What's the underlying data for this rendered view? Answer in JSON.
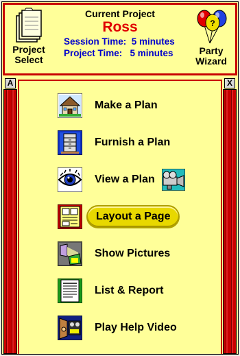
{
  "header": {
    "current_project_label": "Current Project",
    "project_name": "Ross",
    "session_time": "Session Time:  5 minutes",
    "project_time": "Project Time:   5 minutes",
    "project_select_label_1": "Project",
    "project_select_label_2": "Select",
    "party_wizard_label_1": "Party",
    "party_wizard_label_2": "Wizard"
  },
  "frame": {
    "left_button": "A",
    "right_button": "X"
  },
  "menu": {
    "items": [
      {
        "label": "Make a Plan",
        "icon": "house-icon"
      },
      {
        "label": "Furnish a Plan",
        "icon": "furniture-icon"
      },
      {
        "label": "View a Plan",
        "icon": "eye-icon"
      },
      {
        "label": "Layout a Page",
        "icon": "page-layout-icon"
      },
      {
        "label": "Show Pictures",
        "icon": "projector-icon"
      },
      {
        "label": "List & Report",
        "icon": "report-icon"
      },
      {
        "label": "Play Help Video",
        "icon": "video-icon"
      }
    ],
    "selected": "Layout a Page",
    "extra_icon": "video-camera-icon"
  },
  "colors": {
    "background": "#ffff99",
    "frame_red": "#c80000",
    "project_name": "#e00000",
    "time_text": "#0000cc",
    "selected_pill": "#e8d800"
  }
}
